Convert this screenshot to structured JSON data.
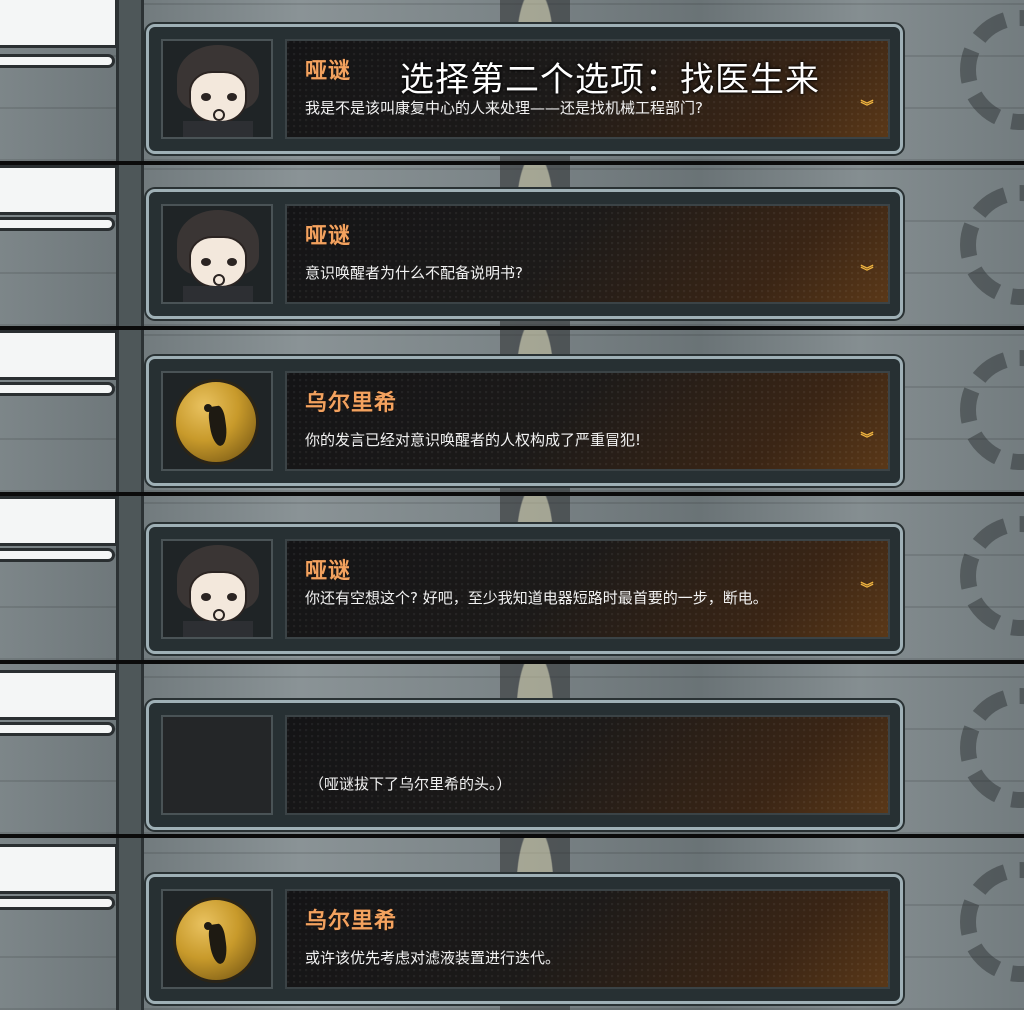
{
  "caption": "选择第二个选项：找医生来",
  "dialogues": [
    {
      "speaker": "哑谜",
      "portrait": "hair-man-portrait",
      "text": "我是不是该叫康复中心的人来处理——还是找机械工程部门?"
    },
    {
      "speaker": "哑谜",
      "portrait": "hair-man-portrait",
      "text": "意识唤醒者为什么不配备说明书?"
    },
    {
      "speaker": "乌尔里希",
      "portrait": "gold-helmet-portrait",
      "text": "你的发言已经对意识唤醒者的人权构成了严重冒犯!"
    },
    {
      "speaker": "哑谜",
      "portrait": "hair-man-portrait",
      "text": "你还有空想这个? 好吧，至少我知道电器短路时最首要的一步，断电。"
    },
    {
      "speaker": "",
      "portrait": "empty-portrait",
      "text": "（哑谜拔下了乌尔里希的头。）"
    },
    {
      "speaker": "乌尔里希",
      "portrait": "gold-helmet-portrait",
      "text": "或许该优先考虑对滤液装置进行迭代。"
    }
  ],
  "advance_icon": "double-chevron-down-icon",
  "colors": {
    "speaker": "#f3a25f",
    "chevron": "#f2b640",
    "frame": "#9fb0b6"
  }
}
